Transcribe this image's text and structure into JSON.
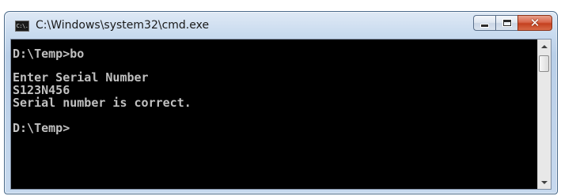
{
  "window": {
    "title": "C:\\Windows\\system32\\cmd.exe",
    "icon": "cmd-app-icon",
    "icon_text": "C:\\."
  },
  "controls": {
    "minimize_icon": "minimize-icon",
    "maximize_icon": "maximize-icon",
    "close_icon": "close-icon",
    "close_glyph": "✕",
    "close_color": "#c7452a"
  },
  "console": {
    "lines": [
      "D:\\Temp>bo",
      "Enter Serial Number",
      "S123N456",
      "Serial number is correct.",
      "D:\\Temp>"
    ],
    "text_color": "#c0c0c0",
    "background_color": "#000000"
  },
  "scrollbar": {
    "up_icon": "scroll-up-arrow-icon",
    "down_icon": "scroll-down-arrow-icon"
  }
}
